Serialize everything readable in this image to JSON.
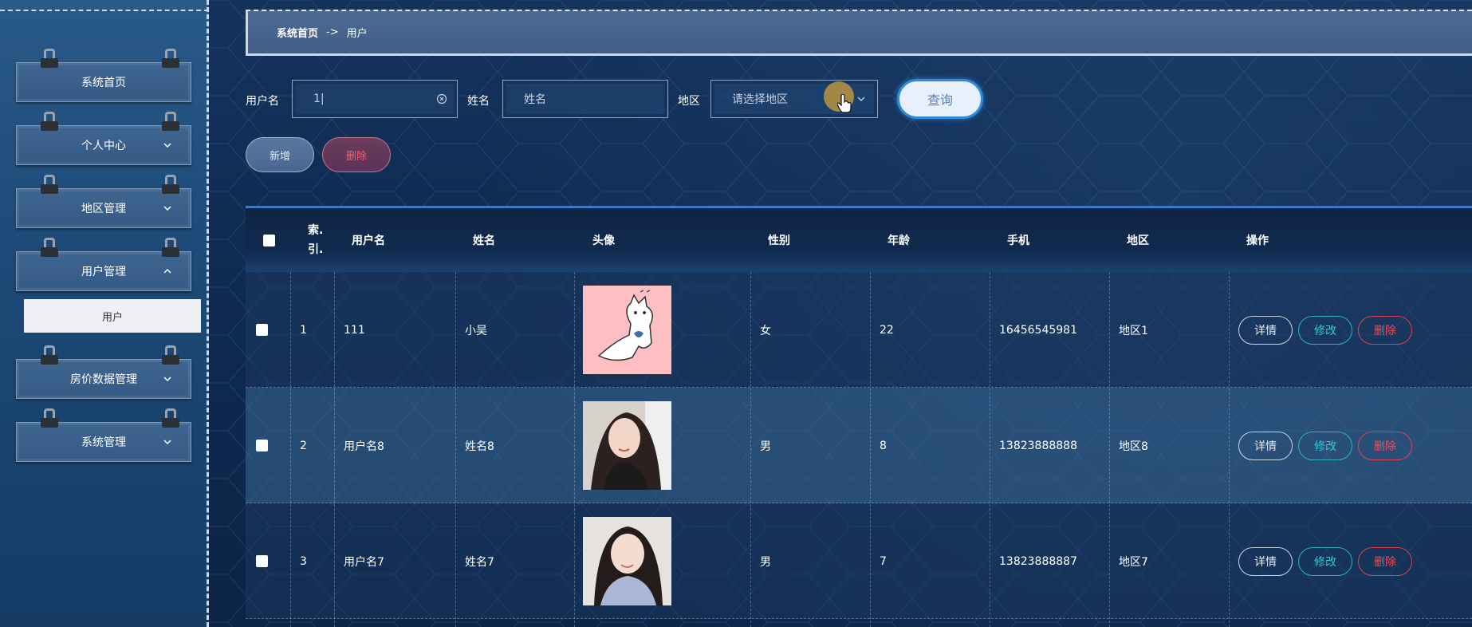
{
  "breadcrumb": {
    "home": "系统首页",
    "separator": "->",
    "current": "用户"
  },
  "sidebar": {
    "items": [
      {
        "label": "系统首页"
      },
      {
        "label": "个人中心"
      },
      {
        "label": "地区管理"
      },
      {
        "label": "用户管理"
      },
      {
        "label": "房价数据管理"
      },
      {
        "label": "系统管理"
      }
    ],
    "submenu_active": "用户"
  },
  "search": {
    "username_label": "用户名",
    "username_value": "1|",
    "name_label": "姓名",
    "name_placeholder": "姓名",
    "region_label": "地区",
    "region_placeholder": "请选择地区",
    "query_button": "查询"
  },
  "actions": {
    "add": "新增",
    "delete": "删除"
  },
  "table": {
    "headers": [
      "索引",
      "用户名",
      "姓名",
      "头像",
      "性别",
      "年龄",
      "手机",
      "地区",
      "操作"
    ],
    "index_header_line1": "索.",
    "index_header_line2": "引.",
    "rows": [
      {
        "index": "1",
        "username": "111",
        "name": "小吴",
        "gender": "女",
        "age": "22",
        "phone": "16456545981",
        "region": "地区1",
        "avatar": "cartoon-cat-avatar"
      },
      {
        "index": "2",
        "username": "用户名8",
        "name": "姓名8",
        "gender": "男",
        "age": "8",
        "phone": "13823888888",
        "region": "地区8",
        "avatar": "photo-avatar"
      },
      {
        "index": "3",
        "username": "用户名7",
        "name": "姓名7",
        "gender": "男",
        "age": "7",
        "phone": "13823888887",
        "region": "地区7",
        "avatar": "photo-avatar"
      }
    ],
    "row_actions": {
      "detail": "详情",
      "edit": "修改",
      "remove": "删除"
    }
  },
  "colors": {
    "accent": "#2e8bdc",
    "danger": "#ef4c58",
    "edit": "#38c6d3",
    "table_header_top": "#3a7ac4"
  }
}
